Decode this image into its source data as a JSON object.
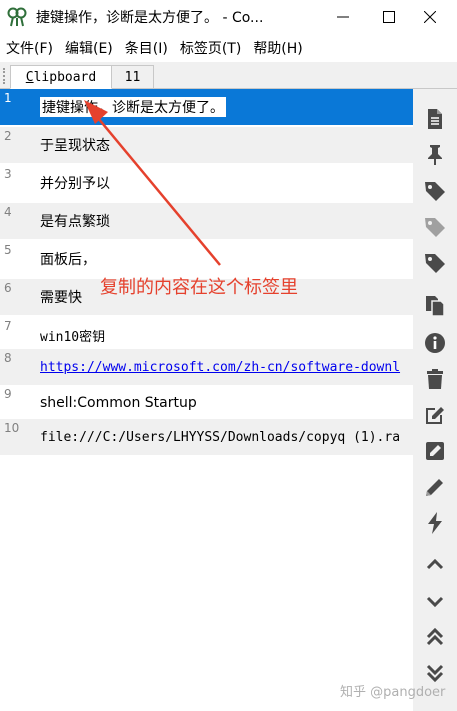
{
  "window": {
    "title": "捷键操作，诊断是太方便了。 - Co...",
    "app_icon": "copyq-octopus-icon"
  },
  "menu": [
    "文件(F)",
    "编辑(E)",
    "条目(I)",
    "标签页(T)",
    "帮助(H)"
  ],
  "tabs": {
    "active_prefix": "C",
    "active_rest": "lipboard",
    "inactive": "11"
  },
  "items": [
    {
      "num": "1",
      "text": "捷键操作，诊断是太方便了。"
    },
    {
      "num": "2",
      "text": "于呈现状态"
    },
    {
      "num": "3",
      "text": "并分别予以"
    },
    {
      "num": "4",
      "text": "是有点繁琐"
    },
    {
      "num": "5",
      "text": "面板后，"
    },
    {
      "num": "6",
      "text": "需要快"
    },
    {
      "num": "7",
      "text": "win10密钥"
    },
    {
      "num": "8",
      "text": "https://www.microsoft.com/zh-cn/software-downl"
    },
    {
      "num": "9",
      "text": "shell:Common Startup"
    },
    {
      "num": "10",
      "text": "file:///C:/Users/LHYYSS/Downloads/copyq (1).ra"
    }
  ],
  "annotation": "复制的内容在这个标签里",
  "watermark": "知乎 @pangdoer",
  "toolbar_icons": [
    "document-icon",
    "pin-icon",
    "tag-icon",
    "tag-gray-icon",
    "tag-icon-2",
    "copy-icon",
    "info-icon",
    "trash-icon",
    "edit-box-icon",
    "edit-square-icon",
    "pencil-icon",
    "bolt-icon",
    "chevron-up-icon",
    "chevron-down-icon",
    "double-chevron-up-icon",
    "double-chevron-down-icon"
  ],
  "colors": {
    "selection": "#0a78d7",
    "annotation": "#e5412d",
    "icon": "#4a4a4a"
  }
}
